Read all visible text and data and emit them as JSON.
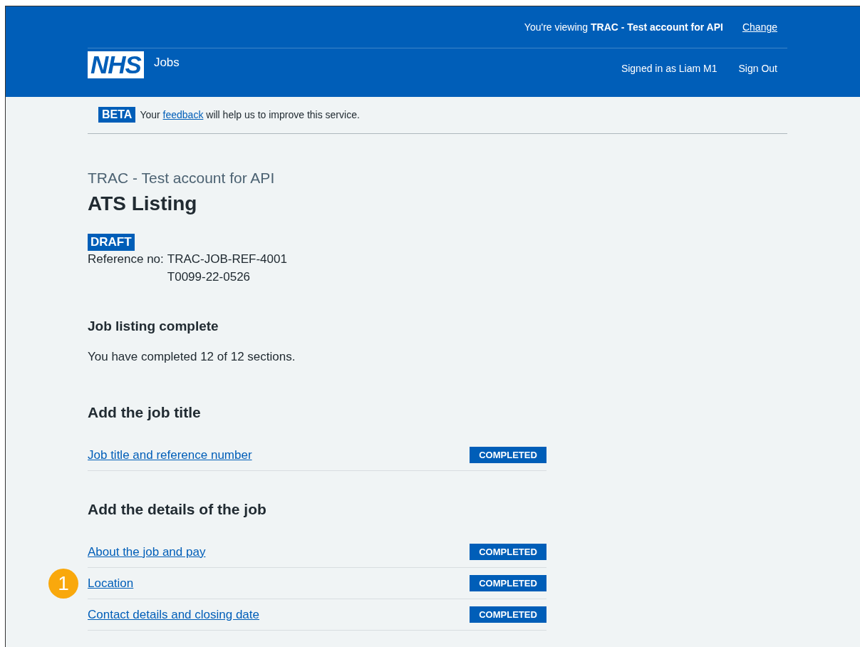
{
  "header": {
    "viewing": "You're viewing **TRAC - Test account for API**",
    "change_link": "Change",
    "logo": "NHS",
    "service": "Jobs",
    "signed_in": "Signed in as Liam M1",
    "sign_out": "Sign Out"
  },
  "beta_banner": {
    "tag": "BETA",
    "before": "Your",
    "link": "feedback",
    "after": "will help us to improve this service."
  },
  "caption": "TRAC - Test account for API",
  "title": "ATS Listing",
  "status_tag": "DRAFT",
  "reference": {
    "label": "Reference no:",
    "values": [
      "TRAC-JOB-REF-4001",
      "T0099-22-0526"
    ]
  },
  "summary": {
    "heading": "Job listing complete",
    "text": "You have completed 12 of 12 sections."
  },
  "sections": [
    {
      "heading": "Add the job title",
      "items": [
        {
          "link": "Job title and reference number",
          "status": "COMPLETED"
        }
      ]
    },
    {
      "heading": "Add the details of the job",
      "items": [
        {
          "link": "About the job and pay",
          "status": "COMPLETED"
        },
        {
          "link": "Location",
          "status": "COMPLETED",
          "callout": "1"
        },
        {
          "link": "Contact details and closing date",
          "status": "COMPLETED"
        }
      ]
    }
  ]
}
